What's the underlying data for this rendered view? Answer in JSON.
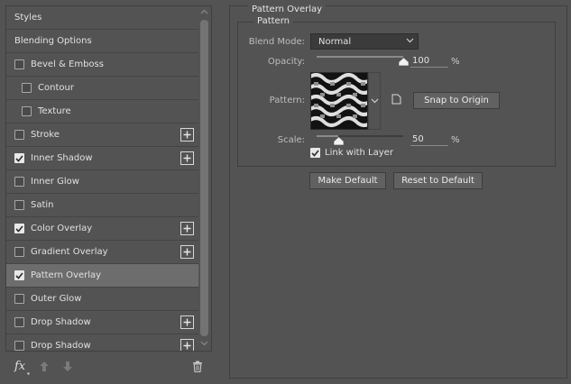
{
  "styles_list": {
    "items": [
      {
        "label": "Styles",
        "type": "header",
        "checked": null,
        "indent": false,
        "has_plus": false,
        "selected": false
      },
      {
        "label": "Blending Options",
        "type": "header",
        "checked": null,
        "indent": false,
        "has_plus": false,
        "selected": false
      },
      {
        "label": "Bevel & Emboss",
        "type": "effect",
        "checked": false,
        "indent": false,
        "has_plus": false,
        "selected": false
      },
      {
        "label": "Contour",
        "type": "effect",
        "checked": false,
        "indent": true,
        "has_plus": false,
        "selected": false
      },
      {
        "label": "Texture",
        "type": "effect",
        "checked": false,
        "indent": true,
        "has_plus": false,
        "selected": false
      },
      {
        "label": "Stroke",
        "type": "effect",
        "checked": false,
        "indent": false,
        "has_plus": true,
        "selected": false
      },
      {
        "label": "Inner Shadow",
        "type": "effect",
        "checked": true,
        "indent": false,
        "has_plus": true,
        "selected": false
      },
      {
        "label": "Inner Glow",
        "type": "effect",
        "checked": false,
        "indent": false,
        "has_plus": false,
        "selected": false
      },
      {
        "label": "Satin",
        "type": "effect",
        "checked": false,
        "indent": false,
        "has_plus": false,
        "selected": false
      },
      {
        "label": "Color Overlay",
        "type": "effect",
        "checked": true,
        "indent": false,
        "has_plus": true,
        "selected": false
      },
      {
        "label": "Gradient Overlay",
        "type": "effect",
        "checked": false,
        "indent": false,
        "has_plus": true,
        "selected": false
      },
      {
        "label": "Pattern Overlay",
        "type": "effect",
        "checked": true,
        "indent": false,
        "has_plus": false,
        "selected": true
      },
      {
        "label": "Outer Glow",
        "type": "effect",
        "checked": false,
        "indent": false,
        "has_plus": false,
        "selected": false
      },
      {
        "label": "Drop Shadow",
        "type": "effect",
        "checked": false,
        "indent": false,
        "has_plus": true,
        "selected": false
      },
      {
        "label": "Drop Shadow",
        "type": "effect",
        "checked": false,
        "indent": false,
        "has_plus": true,
        "selected": false
      }
    ]
  },
  "toolbar": {
    "fx_label": "fx",
    "fx_icon": "fx-icon",
    "move_up_icon": "arrow-up-icon",
    "move_down_icon": "arrow-down-icon",
    "delete_icon": "trash-icon"
  },
  "pattern_overlay": {
    "group_title": "Pattern Overlay",
    "section_title": "Pattern",
    "blend_mode": {
      "label": "Blend Mode:",
      "value": "Normal"
    },
    "opacity": {
      "label": "Opacity:",
      "value": "100",
      "unit": "%",
      "fraction": 1.0
    },
    "pattern": {
      "label": "Pattern:"
    },
    "snap_button": "Snap to Origin",
    "scale": {
      "label": "Scale:",
      "value": "50",
      "unit": "%",
      "fraction": 0.25
    },
    "link_with_layer": {
      "label": "Link with Layer",
      "checked": true
    },
    "make_default": "Make Default",
    "reset_default": "Reset to Default"
  },
  "colors": {
    "background": "#535353",
    "selected_row": "#6d6d6d",
    "border": "#3f3f3f",
    "field_bg": "#3b3b3b",
    "text": "#e1e1e1"
  }
}
